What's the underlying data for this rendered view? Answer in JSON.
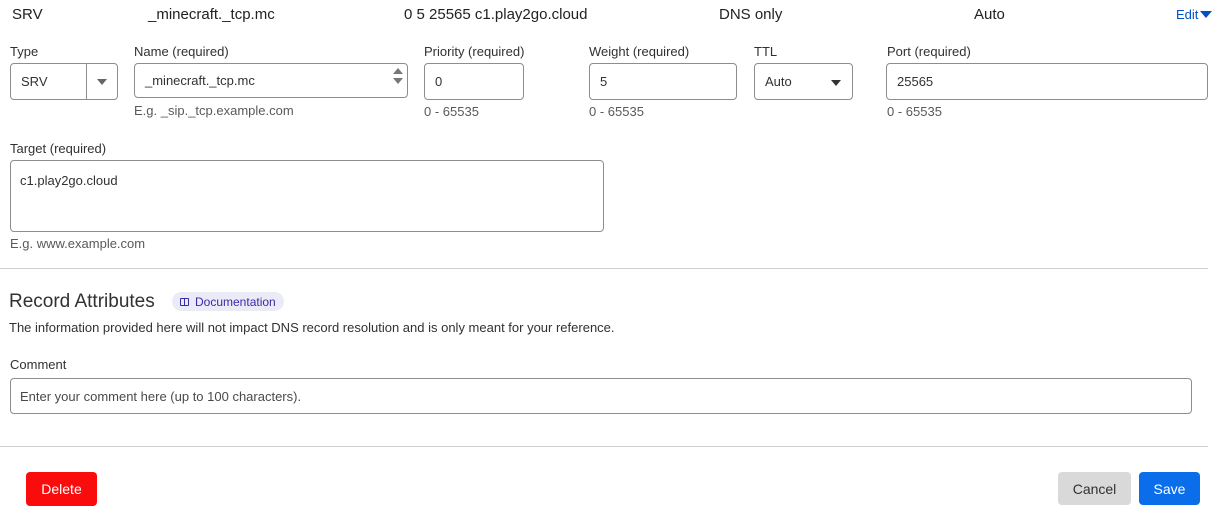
{
  "summary": {
    "type": "SRV",
    "name": "_minecraft._tcp.mc",
    "content": "0 5 25565 c1.play2go.cloud",
    "proxy_status": "DNS only",
    "ttl": "Auto",
    "edit_label": "Edit"
  },
  "form": {
    "type": {
      "label": "Type",
      "value": "SRV"
    },
    "name": {
      "label": "Name (required)",
      "value": "_minecraft._tcp.mc",
      "hint": "E.g. _sip._tcp.example.com"
    },
    "priority": {
      "label": "Priority (required)",
      "value": "0",
      "hint": "0 - 65535"
    },
    "weight": {
      "label": "Weight (required)",
      "value": "5",
      "hint": "0 - 65535"
    },
    "ttl": {
      "label": "TTL",
      "value": "Auto"
    },
    "port": {
      "label": "Port (required)",
      "value": "25565",
      "hint": "0 - 65535"
    },
    "target": {
      "label": "Target (required)",
      "value": "c1.play2go.cloud",
      "hint": "E.g. www.example.com"
    }
  },
  "record_attributes": {
    "title": "Record Attributes",
    "doc_label": "Documentation",
    "description": "The information provided here will not impact DNS record resolution and is only meant for your reference.",
    "comment_label": "Comment",
    "comment_placeholder": "Enter your comment here (up to 100 characters)."
  },
  "actions": {
    "delete": "Delete",
    "cancel": "Cancel",
    "save": "Save"
  },
  "colors": {
    "delete_bg": "#fb0c0c",
    "save_bg": "#0a6eea",
    "cancel_bg": "#d9d9d9",
    "link": "#0051c3",
    "doc_badge_bg": "#ebeaf7"
  },
  "icons": {
    "edit": "caret-down-icon",
    "documentation": "book-icon",
    "select": "chevron-down-icon"
  }
}
